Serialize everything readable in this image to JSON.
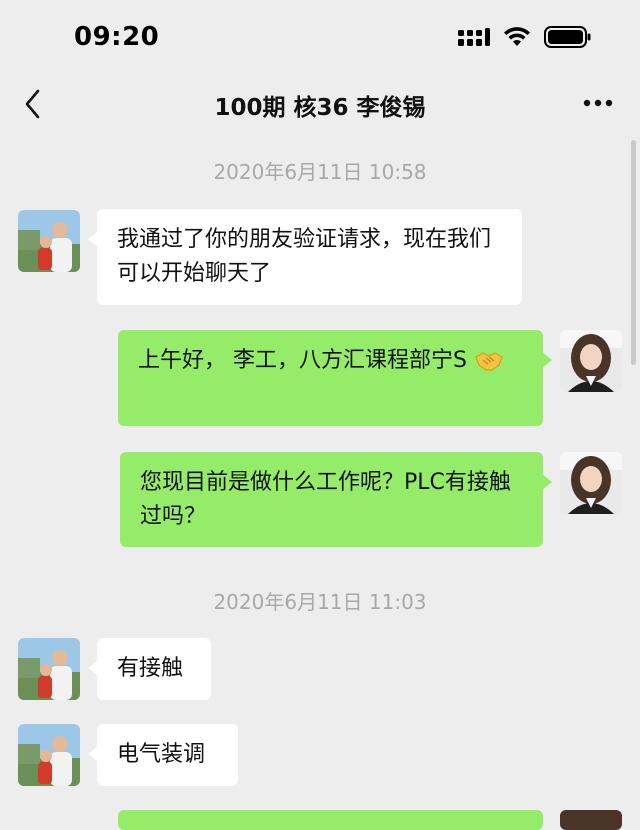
{
  "status_bar": {
    "time": "09:20",
    "icons": [
      "cellular-signal-icon",
      "wifi-icon",
      "battery-icon"
    ]
  },
  "nav": {
    "title": "100期 核36 李俊锡",
    "back_icon": "chevron-left-icon",
    "more_icon": "more-dots-icon"
  },
  "messages": [
    {
      "type": "timestamp",
      "text": "2020年6月11日 10:58"
    },
    {
      "type": "received",
      "sender_avatar": "contact-avatar",
      "text": "我通过了你的朋友验证请求，现在我们可以开始聊天了"
    },
    {
      "type": "sent",
      "sender_avatar": "my-avatar",
      "text": "上午好， 李工，八方汇课程部宁S",
      "emoji": "handshake-emoji"
    },
    {
      "type": "sent",
      "sender_avatar": "my-avatar",
      "text": "您现目前是做什么工作呢？PLC有接触过吗？"
    },
    {
      "type": "timestamp",
      "text": "2020年6月11日 11:03"
    },
    {
      "type": "received",
      "sender_avatar": "contact-avatar",
      "text": "有接触"
    },
    {
      "type": "received",
      "sender_avatar": "contact-avatar",
      "text": "电气装调"
    }
  ],
  "colors": {
    "background": "#ededed",
    "sent_bubble": "#95ec69",
    "received_bubble": "#ffffff",
    "timestamp_text": "#a8a8a8"
  }
}
